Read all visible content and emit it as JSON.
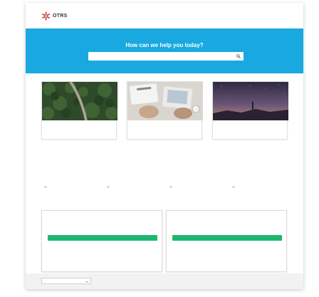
{
  "header": {
    "brand": "OTRS",
    "nav_top": [
      "",
      ""
    ],
    "nav_bottom": [
      "",
      ""
    ]
  },
  "hero": {
    "title": "How can we help you today?",
    "search_placeholder": ""
  },
  "cards": [
    {
      "title": "",
      "desc": ""
    },
    {
      "title": "",
      "desc": ""
    },
    {
      "title": "",
      "desc": ""
    }
  ],
  "columns": [
    {
      "title": "",
      "links": [
        "",
        "",
        ""
      ],
      "select": ""
    },
    {
      "title": "",
      "links": [
        "",
        "",
        ""
      ],
      "select": ""
    },
    {
      "title": "",
      "links": [
        "",
        "",
        ""
      ],
      "select": ""
    },
    {
      "title": "",
      "links": [
        "",
        "",
        ""
      ],
      "select": ""
    }
  ],
  "boxes": [
    {
      "title": "",
      "desc": "",
      "button": "",
      "links": [
        "",
        ""
      ]
    },
    {
      "title": "",
      "desc": "",
      "button": "",
      "links": [
        "",
        ""
      ]
    }
  ],
  "footer": {
    "language": "",
    "links": [
      "",
      "",
      ""
    ]
  },
  "colors": {
    "hero": "#1aa8e0",
    "accent_green": "#1db86e",
    "link_blue": "#1aa0d8",
    "logo_red": "#d8232a"
  }
}
